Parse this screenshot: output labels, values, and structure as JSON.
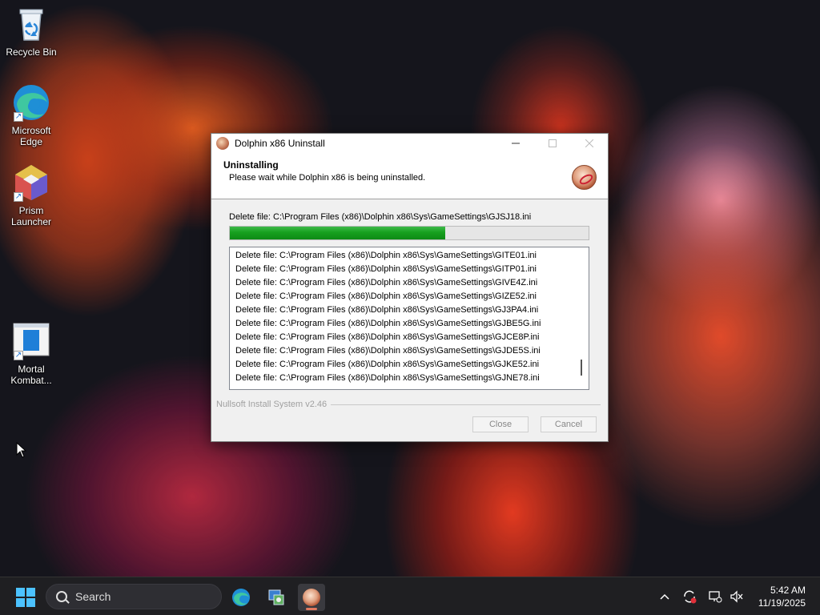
{
  "desktop": {
    "icons": [
      {
        "label": "Recycle Bin"
      },
      {
        "label": "Microsoft Edge"
      },
      {
        "label": "Prism Launcher"
      },
      {
        "label": "Mortal Kombat..."
      }
    ]
  },
  "dialog": {
    "title": "Dolphin x86 Uninstall",
    "header_title": "Uninstalling",
    "header_subtitle": "Please wait while Dolphin x86 is being uninstalled.",
    "status": "Delete file: C:\\Program Files (x86)\\Dolphin x86\\Sys\\GameSettings\\GJSJ18.ini",
    "progress_fraction": 0.6,
    "log_lines": [
      "Delete file: C:\\Program Files (x86)\\Dolphin x86\\Sys\\GameSettings\\GITE01.ini",
      "Delete file: C:\\Program Files (x86)\\Dolphin x86\\Sys\\GameSettings\\GITP01.ini",
      "Delete file: C:\\Program Files (x86)\\Dolphin x86\\Sys\\GameSettings\\GIVE4Z.ini",
      "Delete file: C:\\Program Files (x86)\\Dolphin x86\\Sys\\GameSettings\\GIZE52.ini",
      "Delete file: C:\\Program Files (x86)\\Dolphin x86\\Sys\\GameSettings\\GJ3PA4.ini",
      "Delete file: C:\\Program Files (x86)\\Dolphin x86\\Sys\\GameSettings\\GJBE5G.ini",
      "Delete file: C:\\Program Files (x86)\\Dolphin x86\\Sys\\GameSettings\\GJCE8P.ini",
      "Delete file: C:\\Program Files (x86)\\Dolphin x86\\Sys\\GameSettings\\GJDE5S.ini",
      "Delete file: C:\\Program Files (x86)\\Dolphin x86\\Sys\\GameSettings\\GJKE52.ini",
      "Delete file: C:\\Program Files (x86)\\Dolphin x86\\Sys\\GameSettings\\GJNE78.ini"
    ],
    "brand": "Nullsoft Install System v2.46",
    "close_label": "Close",
    "cancel_label": "Cancel"
  },
  "taskbar": {
    "search_label": "Search",
    "time": "5:42 AM",
    "date": "11/19/2025"
  },
  "colors": {
    "progress": "#16a01f",
    "start_accent": "#4cc2ff"
  }
}
